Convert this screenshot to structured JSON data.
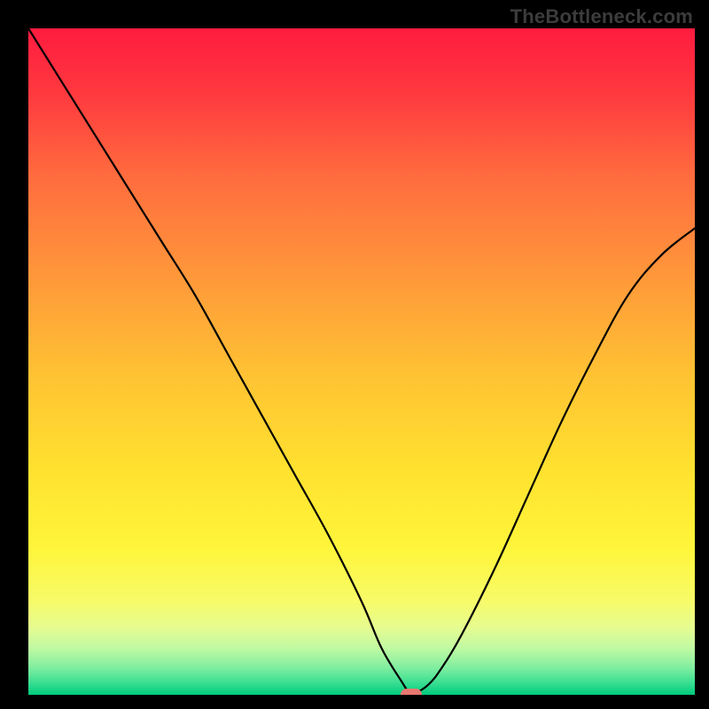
{
  "watermark": "TheBottleneck.com",
  "chart_data": {
    "type": "line",
    "title": "",
    "xlabel": "",
    "ylabel": "",
    "xlim": [
      0,
      100
    ],
    "ylim": [
      0,
      100
    ],
    "x": [
      0,
      5,
      10,
      15,
      20,
      25,
      30,
      35,
      40,
      45,
      50,
      53,
      56,
      57,
      58,
      60,
      62,
      65,
      70,
      75,
      80,
      85,
      90,
      95,
      100
    ],
    "values": [
      100,
      92,
      84,
      76,
      68,
      60,
      51,
      42,
      33,
      24,
      14,
      7,
      2,
      0.6,
      0.3,
      1.5,
      4,
      9,
      19,
      30,
      41,
      51,
      60,
      66,
      70
    ],
    "optimal_x": 57.5,
    "marker": {
      "x": 57.5,
      "y": 0,
      "width_pct": 3.2,
      "height_pct": 1.9
    },
    "gradient_stops": [
      {
        "offset": 0.0,
        "color": "#ff1b3f"
      },
      {
        "offset": 0.1,
        "color": "#ff3a3f"
      },
      {
        "offset": 0.22,
        "color": "#ff6b3e"
      },
      {
        "offset": 0.38,
        "color": "#ff9a3a"
      },
      {
        "offset": 0.52,
        "color": "#ffc233"
      },
      {
        "offset": 0.66,
        "color": "#ffe12f"
      },
      {
        "offset": 0.78,
        "color": "#fff53a"
      },
      {
        "offset": 0.86,
        "color": "#f7fb69"
      },
      {
        "offset": 0.9,
        "color": "#e5fc91"
      },
      {
        "offset": 0.93,
        "color": "#c0f9a2"
      },
      {
        "offset": 0.96,
        "color": "#7eeea0"
      },
      {
        "offset": 0.985,
        "color": "#30dc8f"
      },
      {
        "offset": 1.0,
        "color": "#00c97b"
      }
    ]
  }
}
